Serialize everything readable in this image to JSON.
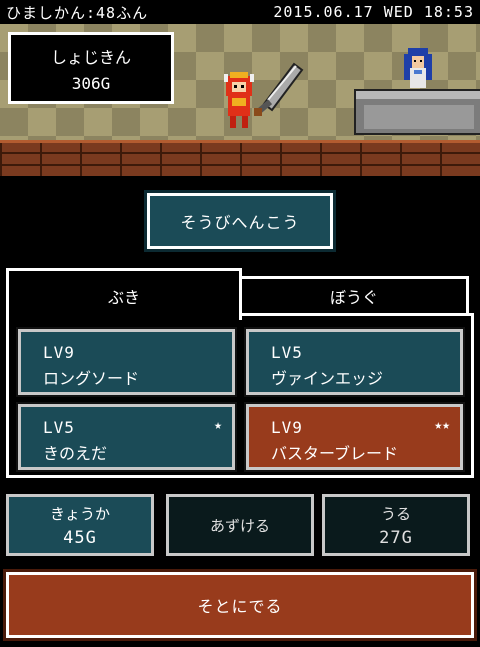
{
  "status": {
    "free_time": "ひましかん:48ふん",
    "datetime": "2015.06.17 WED 18:53"
  },
  "wallet": {
    "label": "しょじきん",
    "amount": "306G"
  },
  "equip_button": "そうびへんこう",
  "tabs": [
    {
      "label": "ぶき",
      "active": true
    },
    {
      "label": "ぼうぐ",
      "active": false
    }
  ],
  "items": [
    {
      "level": "LV9",
      "name": "ロングソード",
      "stars": "",
      "color": "#1b4b57"
    },
    {
      "level": "LV5",
      "name": "ヴァインエッジ",
      "stars": "",
      "color": "#1b4b57"
    },
    {
      "level": "LV5",
      "name": "きのえだ",
      "stars": "★",
      "color": "#1b4b57"
    },
    {
      "level": "LV9",
      "name": "バスターブレード",
      "stars": "★★",
      "color": "#983b1c"
    }
  ],
  "actions": {
    "enhance": {
      "label": "きょうか",
      "price": "45G"
    },
    "deposit": {
      "label": "あずける"
    },
    "sell": {
      "label": "うる",
      "price": "27G"
    }
  },
  "exit_button": "そとにでる",
  "icons": [
    "hero-sprite-icon",
    "shopkeeper-sprite-icon",
    "sword-icon",
    "star-icon"
  ]
}
